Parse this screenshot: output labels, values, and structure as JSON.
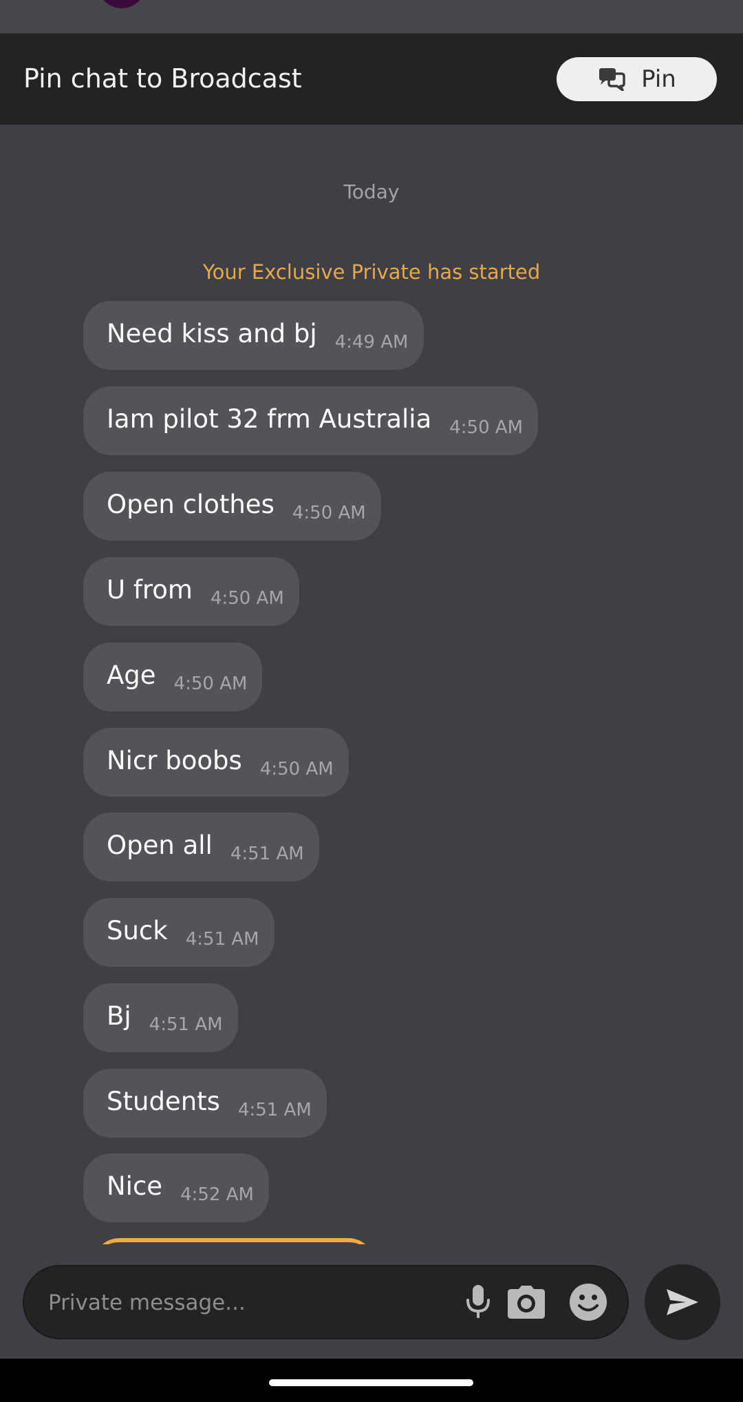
{
  "pin_bar": {
    "title": "Pin chat to Broadcast",
    "button_label": "Pin"
  },
  "chat": {
    "date_label": "Today",
    "system_message": "Your Exclusive Private has started",
    "messages": [
      {
        "text": "Need kiss and bj",
        "time": "4:49 AM"
      },
      {
        "text": "Iam pilot 32 frm Australia",
        "time": "4:50 AM"
      },
      {
        "text": "Open clothes",
        "time": "4:50 AM"
      },
      {
        "text": "U from",
        "time": "4:50 AM"
      },
      {
        "text": "Age",
        "time": "4:50 AM"
      },
      {
        "text": "Nicr boobs",
        "time": "4:50 AM"
      },
      {
        "text": "Open all",
        "time": "4:51 AM"
      },
      {
        "text": "Suck",
        "time": "4:51 AM"
      },
      {
        "text": "Bj",
        "time": "4:51 AM"
      },
      {
        "text": "Students",
        "time": "4:51 AM"
      },
      {
        "text": "Nice",
        "time": "4:52 AM"
      }
    ]
  },
  "composer": {
    "placeholder": "Private message...",
    "value": "",
    "icons": [
      "microphone-icon",
      "camera-icon",
      "emoji-icon",
      "send-icon"
    ]
  },
  "colors": {
    "background": "#3f4045",
    "bar_background": "#232324",
    "bubble": "#545458",
    "system_accent": "#e8a84a",
    "pin_button": "#efefef"
  }
}
